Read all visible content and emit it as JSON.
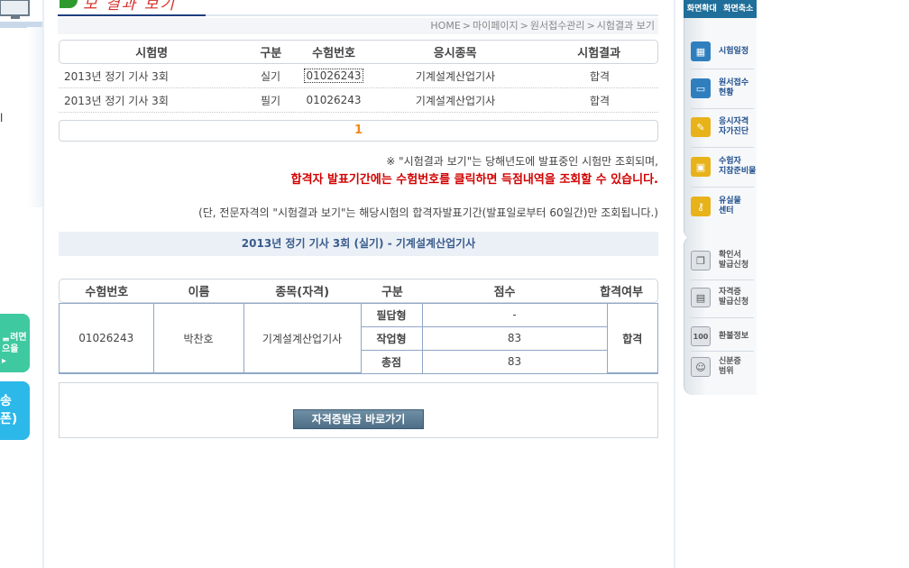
{
  "left": {
    "mark": "l",
    "button1_lines": [
      "ᆯ려면",
      "으을",
      "▸"
    ],
    "button2_lines": [
      "송",
      "폰)"
    ]
  },
  "banner": {
    "title": "모 결과 보기"
  },
  "breadcrumb": [
    "HOME",
    "마이페이지",
    "원서접수관리",
    "시험결과 보기"
  ],
  "results": {
    "headers": [
      "시험명",
      "구분",
      "수험번호",
      "응시종목",
      "시험결과"
    ],
    "rows": [
      {
        "exam": "2013년 정기 기사 3회",
        "type": "실기",
        "number": "01026243",
        "subject": "기계설계산업기사",
        "result": "합격"
      },
      {
        "exam": "2013년 정기 기사 3회",
        "type": "필기",
        "number": "01026243",
        "subject": "기계설계산업기사",
        "result": "합격"
      }
    ]
  },
  "pager": {
    "current": "1"
  },
  "notices": {
    "line1": "※ \"시험결과 보기\"는 당해년도에 발표중인 시험만 조회되며,",
    "line2": "합격자 발표기간에는 수험번호를 클릭하면 득점내역을 조회할 수 있습니다.",
    "line3": "(단, 전문자격의 \"시험결과 보기\"는 해당시험의 합격자발표기간(발표일로부터 60일간)만 조회됩니다.)"
  },
  "detail": {
    "title": "2013년 정기 기사 3회 (실기) - 기계설계산업기사",
    "headers": [
      "수험번호",
      "이름",
      "종목(자격)",
      "구분",
      "점수",
      "합격여부"
    ],
    "number": "01026243",
    "name": "박찬호",
    "subject": "기계설계산업기사",
    "rows": [
      {
        "type": "필답형",
        "score": "-"
      },
      {
        "type": "작업형",
        "score": "83"
      },
      {
        "type": "총점",
        "score": "83"
      }
    ],
    "result": "합격"
  },
  "issue_button": "자격증발급 바로가기",
  "sidebar": {
    "zoom_in": "화면확대",
    "zoom_out": "화면축소",
    "items": [
      {
        "label_lines": [
          "시험일정"
        ]
      },
      {
        "label_lines": [
          "원서접수",
          "현황"
        ]
      },
      {
        "label_lines": [
          "응시자격",
          "자가진단"
        ]
      },
      {
        "label_lines": [
          "수험자",
          "지참준비물"
        ]
      },
      {
        "label_lines": [
          "유실물",
          "센터"
        ]
      }
    ],
    "items2": [
      {
        "label_lines": [
          "확인서",
          "발급신청"
        ]
      },
      {
        "label_lines": [
          "자격증",
          "발급신청"
        ]
      },
      {
        "label_lines": [
          "환불정보"
        ]
      },
      {
        "label_lines": [
          "신분증",
          "범위"
        ]
      }
    ]
  }
}
